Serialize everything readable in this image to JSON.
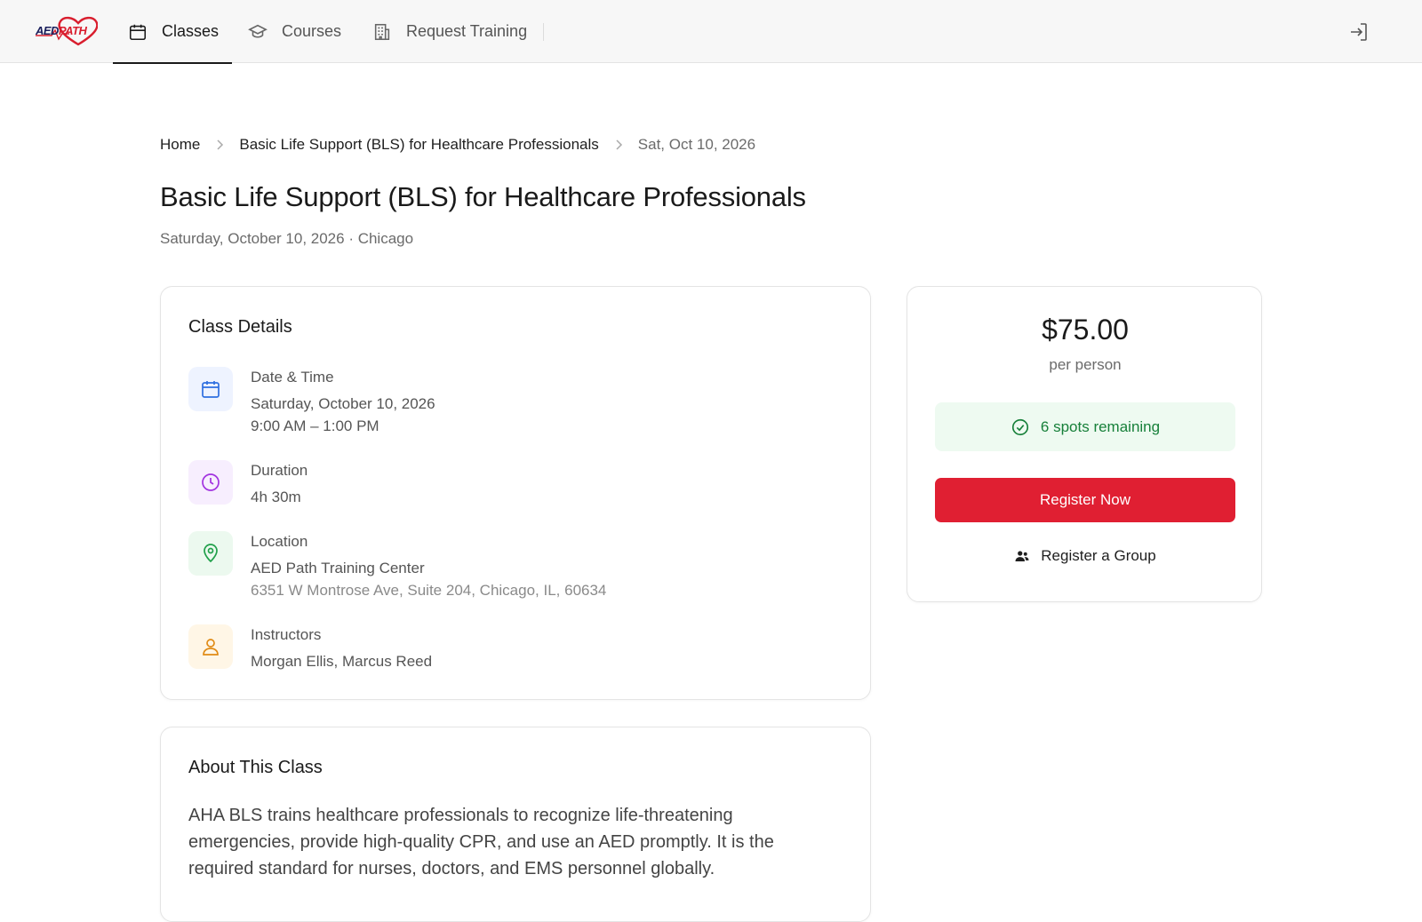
{
  "brand": {
    "logo_text_dark": "AED",
    "logo_text_red": "PATH"
  },
  "nav": {
    "tabs": [
      {
        "label": "Classes",
        "icon": "calendar-icon",
        "active": true
      },
      {
        "label": "Courses",
        "icon": "graduation-cap-icon",
        "active": false
      },
      {
        "label": "Request Training",
        "icon": "building-icon",
        "active": false
      }
    ],
    "login_icon": "login-icon"
  },
  "breadcrumb": {
    "home": "Home",
    "course": "Basic Life Support (BLS) for Healthcare Professionals",
    "current": "Sat, Oct 10, 2026"
  },
  "page": {
    "title": "Basic Life Support (BLS) for Healthcare Professionals",
    "subtitle": "Saturday, October 10, 2026 · Chicago"
  },
  "details": {
    "title": "Class Details",
    "date_time": {
      "label": "Date & Time",
      "date": "Saturday, October 10, 2026",
      "time": "9:00 AM – 1:00 PM",
      "icon": "calendar-icon"
    },
    "duration": {
      "label": "Duration",
      "value": "4h 30m",
      "icon": "clock-icon"
    },
    "location": {
      "label": "Location",
      "name": "AED Path Training Center",
      "address": "6351 W Montrose Ave, Suite 204, Chicago, IL, 60634",
      "icon": "map-pin-icon"
    },
    "instructors": {
      "label": "Instructors",
      "value": "Morgan Ellis, Marcus Reed",
      "icon": "user-icon"
    }
  },
  "about": {
    "title": "About This Class",
    "text": "AHA BLS trains healthcare professionals to recognize life-threatening emergencies, provide high-quality CPR, and use an AED promptly. It is the required standard for nurses, doctors, and EMS personnel globally."
  },
  "pricing": {
    "price": "$75.00",
    "unit": "per person",
    "spots": "6 spots remaining",
    "register_label": "Register Now",
    "group_label": "Register a Group"
  },
  "colors": {
    "accent_red": "#e01f32",
    "success_green": "#17803a",
    "success_bg": "#eefaf1",
    "calendar_tile": "#eef3ff",
    "clock_tile": "#f7eefe",
    "pin_tile": "#ecf9ef",
    "user_tile": "#fff6e6"
  }
}
